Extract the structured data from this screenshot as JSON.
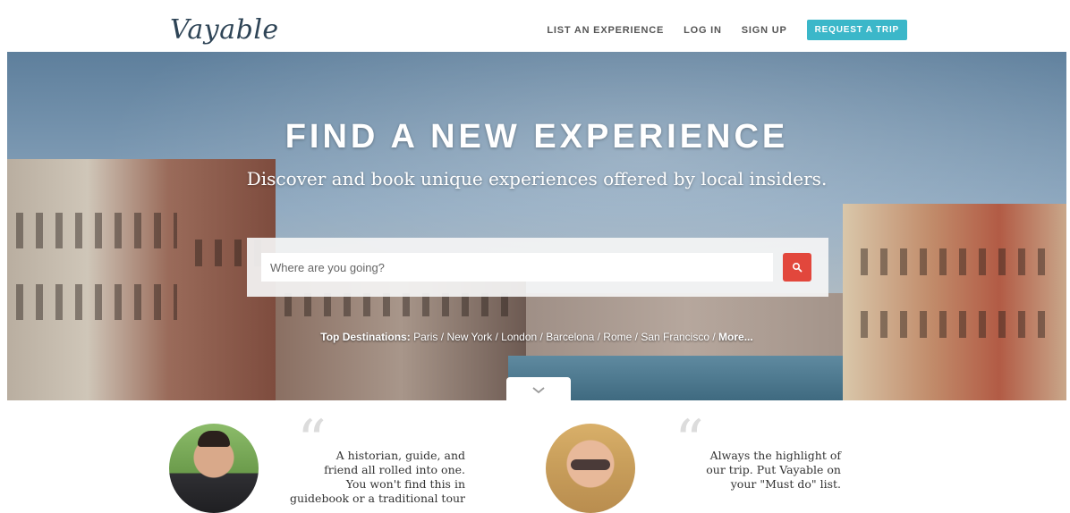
{
  "header": {
    "logo": "Vayable",
    "nav": [
      "LIST AN EXPERIENCE",
      "LOG IN",
      "SIGN UP"
    ],
    "cta": "REQUEST A TRIP"
  },
  "hero": {
    "title": "FIND A NEW EXPERIENCE",
    "subtitle": "Discover and book unique experiences offered by local insiders.",
    "search_placeholder": "Where are you going?",
    "top_destinations_label": "Top Destinations:",
    "destinations": [
      "Paris",
      "New York",
      "London",
      "Barcelona",
      "Rome",
      "San Francisco",
      "More..."
    ]
  },
  "testimonials": [
    {
      "quote": "A historian, guide, and\nfriend all rolled into one.\nYou won't find this in\nguidebook or a traditional tour"
    },
    {
      "quote": "Always the highlight of\nour trip. Put Vayable on\nyour \"Must do\" list."
    }
  ],
  "colors": {
    "accent": "#3bb7c9",
    "search_button": "#e2473c",
    "logo": "#2e4456"
  },
  "icons": {
    "search": "search-icon",
    "scroll_down": "chevron-down-icon",
    "quote": "quote-icon"
  }
}
